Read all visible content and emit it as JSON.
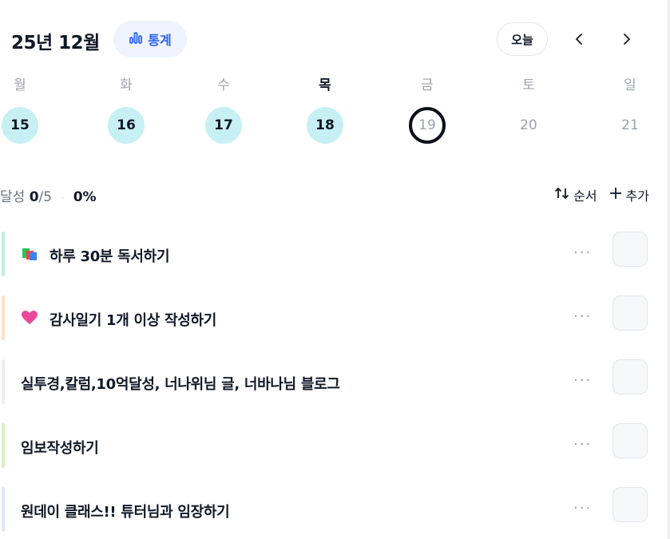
{
  "header": {
    "month_title": "25년 12월",
    "stats_label": "통계",
    "today_label": "오늘"
  },
  "week": {
    "days": [
      {
        "name": "월",
        "num": "15",
        "state": "done"
      },
      {
        "name": "화",
        "num": "16",
        "state": "done"
      },
      {
        "name": "수",
        "num": "17",
        "state": "done"
      },
      {
        "name": "목",
        "num": "18",
        "state": "done"
      },
      {
        "name": "금",
        "num": "19",
        "state": "today"
      },
      {
        "name": "토",
        "num": "20",
        "state": "future"
      },
      {
        "name": "일",
        "num": "21",
        "state": "future"
      }
    ]
  },
  "progress": {
    "label": "달성",
    "done": "0",
    "total": "/5",
    "percent": "0%"
  },
  "tools": {
    "order_label": "순서",
    "add_label": "추가"
  },
  "tasks": [
    {
      "title": "하루 30분 독서하기",
      "icon": "books-icon",
      "bar_color": "#bff0d9"
    },
    {
      "title": "감사일기 1개 이상 작성하기",
      "icon": "heart-icon",
      "bar_color": "#fde2c8"
    },
    {
      "title": "실투경,칼럼,10억달성, 너나위님 글, 너바나님 블로그",
      "icon": null,
      "bar_color": "#eeeeee"
    },
    {
      "title": "임보작성하기",
      "icon": null,
      "bar_color": "#d6f2c1"
    },
    {
      "title": "원데이 클래스!! 튜터님과 임장하기",
      "icon": null,
      "bar_color": "#dbe7fb"
    }
  ],
  "more_label": "···",
  "colors": {
    "accent": "#2b63f0",
    "done_day": "#c7f0f4",
    "today_ring": "#0b0f1a"
  }
}
